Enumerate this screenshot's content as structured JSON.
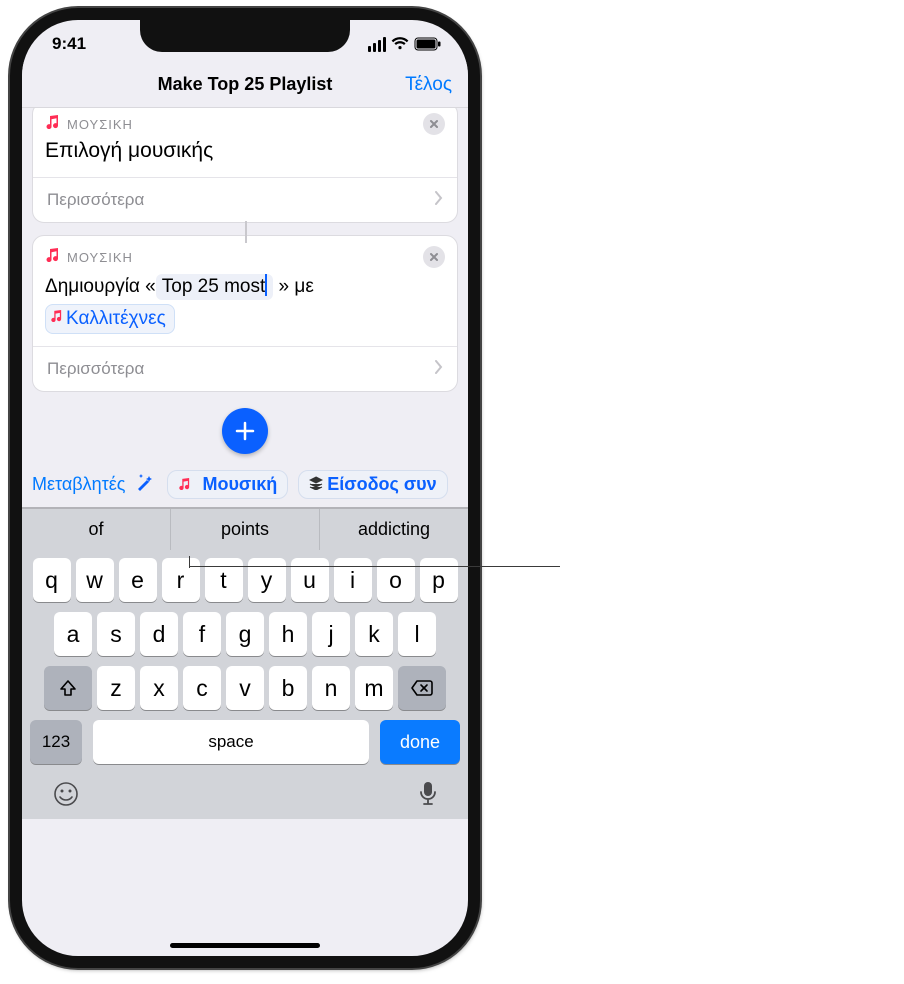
{
  "status": {
    "time": "9:41"
  },
  "nav": {
    "title": "Make Top 25 Playlist",
    "done": "Τέλος"
  },
  "card1": {
    "app": "ΜΟΥΣΙΚΗ",
    "title": "Επιλογή μουσικής",
    "more": "Περισσότερα"
  },
  "card2": {
    "app": "ΜΟΥΣΙΚΗ",
    "prefix": "Δημιουργία «",
    "playlist_name": "Top 25 most",
    "mid": " » με",
    "var_token": "Καλλιτέχνες",
    "more": "Περισσότερα"
  },
  "varbar": {
    "label": "Μεταβλητές",
    "pill_music": "Μουσική",
    "pill_input": "Είσοδος συν"
  },
  "predict": {
    "a": "of",
    "b": "points",
    "c": "addicting"
  },
  "keys": {
    "r1": [
      "q",
      "w",
      "e",
      "r",
      "t",
      "y",
      "u",
      "i",
      "o",
      "p"
    ],
    "r2": [
      "a",
      "s",
      "d",
      "f",
      "g",
      "h",
      "j",
      "k",
      "l"
    ],
    "r3": [
      "z",
      "x",
      "c",
      "v",
      "b",
      "n",
      "m"
    ],
    "num": "123",
    "space": "space",
    "done": "done"
  }
}
